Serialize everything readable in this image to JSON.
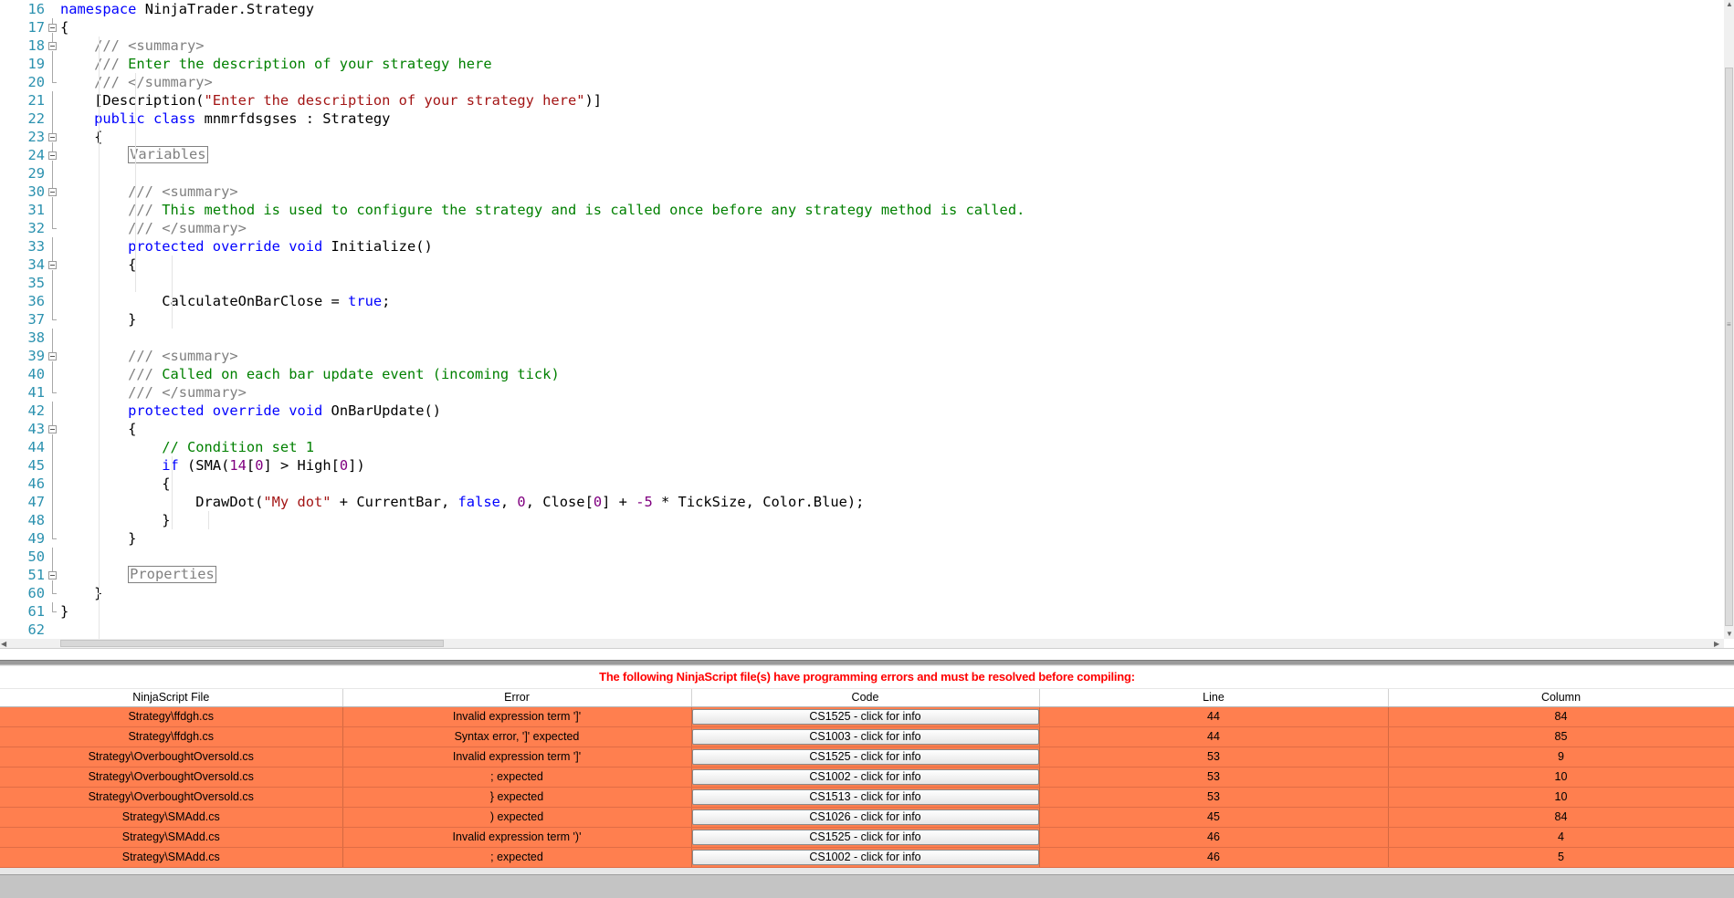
{
  "editor": {
    "lines": [
      {
        "n": "16",
        "fold": "none",
        "tokens": [
          [
            "kw",
            "namespace"
          ],
          [
            "",
            "NinjaTrader.Strategy"
          ]
        ]
      },
      {
        "n": "17",
        "fold": "start",
        "tokens": [
          [
            "",
            "{"
          ]
        ]
      },
      {
        "n": "18",
        "fold": "start",
        "tokens": [
          [
            "",
            "    "
          ],
          [
            "dg",
            "/// <summary>"
          ]
        ]
      },
      {
        "n": "19",
        "fold": "line",
        "tokens": [
          [
            "",
            "    "
          ],
          [
            "dg",
            "/// "
          ],
          [
            "cm",
            "Enter the description of your strategy here"
          ]
        ]
      },
      {
        "n": "20",
        "fold": "end",
        "tokens": [
          [
            "",
            "    "
          ],
          [
            "dg",
            "/// </summary>"
          ]
        ]
      },
      {
        "n": "21",
        "fold": "line",
        "tokens": [
          [
            "",
            "    [Description("
          ],
          [
            "st",
            "\"Enter the description of your strategy here\""
          ],
          [
            "",
            ")]"
          ]
        ]
      },
      {
        "n": "22",
        "fold": "line",
        "tokens": [
          [
            "",
            "    "
          ],
          [
            "kw",
            "public class"
          ],
          [
            "",
            "mnmrfdsgses : Strategy"
          ]
        ]
      },
      {
        "n": "23",
        "fold": "start",
        "tokens": [
          [
            "",
            "    {"
          ]
        ]
      },
      {
        "n": "24",
        "fold": "start",
        "tokens": [
          [
            "",
            "        "
          ],
          [
            "region",
            "Variables"
          ]
        ]
      },
      {
        "n": "29",
        "fold": "line",
        "tokens": [
          [
            "",
            ""
          ]
        ]
      },
      {
        "n": "30",
        "fold": "start",
        "tokens": [
          [
            "",
            "        "
          ],
          [
            "dg",
            "/// <summary>"
          ]
        ]
      },
      {
        "n": "31",
        "fold": "line",
        "tokens": [
          [
            "",
            "        "
          ],
          [
            "dg",
            "/// "
          ],
          [
            "cm",
            "This method is used to configure the strategy and is called once before any strategy method is called."
          ]
        ]
      },
      {
        "n": "32",
        "fold": "end",
        "tokens": [
          [
            "",
            "        "
          ],
          [
            "dg",
            "/// </summary>"
          ]
        ]
      },
      {
        "n": "33",
        "fold": "line",
        "tokens": [
          [
            "",
            "        "
          ],
          [
            "kw",
            "protected override void"
          ],
          [
            "",
            "Initialize()"
          ]
        ]
      },
      {
        "n": "34",
        "fold": "start",
        "tokens": [
          [
            "",
            "        {"
          ]
        ]
      },
      {
        "n": "35",
        "fold": "line",
        "tokens": [
          [
            "",
            ""
          ]
        ]
      },
      {
        "n": "36",
        "fold": "line",
        "tokens": [
          [
            "",
            "            CalculateOnBarClose = "
          ],
          [
            "kw",
            "true"
          ],
          [
            "",
            ";"
          ]
        ]
      },
      {
        "n": "37",
        "fold": "end",
        "tokens": [
          [
            "",
            "        }"
          ]
        ]
      },
      {
        "n": "38",
        "fold": "line",
        "tokens": [
          [
            "",
            ""
          ]
        ]
      },
      {
        "n": "39",
        "fold": "start",
        "tokens": [
          [
            "",
            "        "
          ],
          [
            "dg",
            "/// <summary>"
          ]
        ]
      },
      {
        "n": "40",
        "fold": "line",
        "tokens": [
          [
            "",
            "        "
          ],
          [
            "dg",
            "/// "
          ],
          [
            "cm",
            "Called on each bar update event (incoming tick)"
          ]
        ]
      },
      {
        "n": "41",
        "fold": "end",
        "tokens": [
          [
            "",
            "        "
          ],
          [
            "dg",
            "/// </summary>"
          ]
        ]
      },
      {
        "n": "42",
        "fold": "line",
        "tokens": [
          [
            "",
            "        "
          ],
          [
            "kw",
            "protected override void"
          ],
          [
            "",
            "OnBarUpdate()"
          ]
        ]
      },
      {
        "n": "43",
        "fold": "start",
        "tokens": [
          [
            "",
            "        {"
          ]
        ]
      },
      {
        "n": "44",
        "fold": "line",
        "tokens": [
          [
            "",
            "            "
          ],
          [
            "cm",
            "// Condition set 1"
          ]
        ]
      },
      {
        "n": "45",
        "fold": "line",
        "tokens": [
          [
            "",
            "            "
          ],
          [
            "kw",
            "if"
          ],
          [
            "",
            "(SMA("
          ],
          [
            "nm",
            "14"
          ],
          [
            ")",
            "["
          ],
          [
            "nm",
            "0"
          ],
          [
            "",
            "] > High["
          ],
          [
            "nm",
            "0"
          ],
          [
            "",
            "])"
          ]
        ]
      },
      {
        "n": "46",
        "fold": "line",
        "tokens": [
          [
            "",
            "            {"
          ]
        ]
      },
      {
        "n": "47",
        "fold": "line",
        "tokens": [
          [
            "",
            "                DrawDot("
          ],
          [
            "st",
            "\"My dot\""
          ],
          [
            "",
            " + CurrentBar, "
          ],
          [
            "kw",
            "false"
          ],
          [
            "",
            ", "
          ],
          [
            "nm",
            "0"
          ],
          [
            "",
            ", Close["
          ],
          [
            "nm",
            "0"
          ],
          [
            "",
            "] + "
          ],
          [
            "nm",
            "-5"
          ],
          [
            "",
            " * TickSize, Color.Blue);"
          ]
        ]
      },
      {
        "n": "48",
        "fold": "line",
        "tokens": [
          [
            "",
            "            }"
          ]
        ]
      },
      {
        "n": "49",
        "fold": "end",
        "tokens": [
          [
            "",
            "        }"
          ]
        ]
      },
      {
        "n": "50",
        "fold": "line",
        "tokens": [
          [
            "",
            ""
          ]
        ]
      },
      {
        "n": "51",
        "fold": "start",
        "tokens": [
          [
            "",
            "        "
          ],
          [
            "region",
            "Properties"
          ]
        ]
      },
      {
        "n": "60",
        "fold": "end",
        "tokens": [
          [
            "",
            "    }"
          ]
        ]
      },
      {
        "n": "61",
        "fold": "endlast",
        "tokens": [
          [
            "",
            "}"
          ]
        ]
      },
      {
        "n": "62",
        "fold": "none",
        "tokens": [
          [
            "",
            ""
          ]
        ]
      }
    ]
  },
  "errors": {
    "message": "The following NinjaScript file(s) have programming errors and must be resolved before compiling:",
    "columns": [
      "NinjaScript File",
      "Error",
      "Code",
      "Line",
      "Column"
    ],
    "rows": [
      {
        "file": "Strategy\\ffdgh.cs",
        "error": "Invalid expression term ']'",
        "code": "CS1525 - click for info",
        "line": "44",
        "column": "84"
      },
      {
        "file": "Strategy\\ffdgh.cs",
        "error": "Syntax error, ']' expected",
        "code": "CS1003 - click for info",
        "line": "44",
        "column": "85"
      },
      {
        "file": "Strategy\\OverboughtOversold.cs",
        "error": "Invalid expression term ']'",
        "code": "CS1525 - click for info",
        "line": "53",
        "column": "9"
      },
      {
        "file": "Strategy\\OverboughtOversold.cs",
        "error": "; expected",
        "code": "CS1002 - click for info",
        "line": "53",
        "column": "10"
      },
      {
        "file": "Strategy\\OverboughtOversold.cs",
        "error": "} expected",
        "code": "CS1513 - click for info",
        "line": "53",
        "column": "10"
      },
      {
        "file": "Strategy\\SMAdd.cs",
        "error": ") expected",
        "code": "CS1026 - click for info",
        "line": "45",
        "column": "84"
      },
      {
        "file": "Strategy\\SMAdd.cs",
        "error": "Invalid expression term ')'",
        "code": "CS1525 - click for info",
        "line": "46",
        "column": "4"
      },
      {
        "file": "Strategy\\SMAdd.cs",
        "error": "; expected",
        "code": "CS1002 - click for info",
        "line": "46",
        "column": "5"
      }
    ]
  },
  "colors": {
    "keyword": "#0000ff",
    "comment": "#008000",
    "doc": "#808080",
    "string": "#a31515",
    "number": "#800080",
    "line_number": "#2b91af",
    "error_row": "#ff7f4f",
    "error_message": "#ff0000"
  },
  "icons": {
    "fold": "fold-toggle-icon",
    "scroll_up": "scroll-up-arrow-icon",
    "scroll_down": "scroll-down-arrow-icon",
    "scroll_left": "scroll-left-arrow-icon",
    "scroll_right": "scroll-right-arrow-icon"
  }
}
